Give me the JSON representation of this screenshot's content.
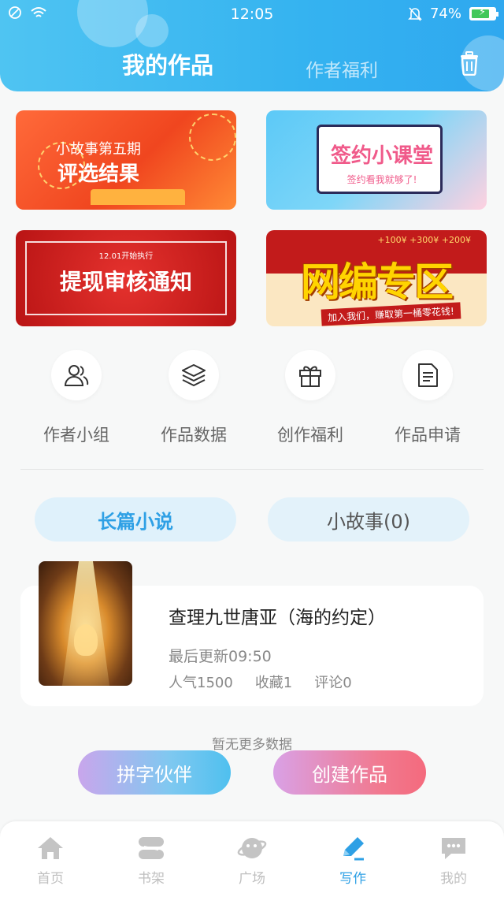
{
  "status_bar": {
    "time": "12:05",
    "battery": "74%"
  },
  "header": {
    "tabs": [
      {
        "label": "我的作品",
        "active": true
      },
      {
        "label": "作者福利",
        "active": false
      }
    ],
    "icons": [
      "trash-icon"
    ]
  },
  "banners": [
    {
      "line1": "小故事第五期",
      "line2": "评选结果"
    },
    {
      "line1": "签约小课堂",
      "line2": "签约看我就够了!"
    },
    {
      "line0": "12.01开始执行",
      "line1": "提现审核通知"
    },
    {
      "line0": "+100¥  +300¥  +200¥",
      "line1": "网编专区",
      "line2": "加入我们，赚取第一桶零花钱!"
    }
  ],
  "quick_menu": [
    {
      "label": "作者小组",
      "icon": "users-icon"
    },
    {
      "label": "作品数据",
      "icon": "layers-icon"
    },
    {
      "label": "创作福利",
      "icon": "gift-icon"
    },
    {
      "label": "作品申请",
      "icon": "document-icon"
    }
  ],
  "segments": [
    {
      "label": "长篇小说",
      "active": true
    },
    {
      "label": "小故事(0)",
      "active": false
    }
  ],
  "work": {
    "title": "查理九世唐亚（海的约定）",
    "updated": "最后更新09:50",
    "popularity": "人气1500",
    "favorites": "收藏1",
    "comments": "评论0"
  },
  "no_more": "暂无更多数据",
  "actions": {
    "partner": "拼字伙伴",
    "create": "创建作品"
  },
  "bottom_nav": [
    {
      "label": "首页",
      "icon": "home-icon",
      "active": false
    },
    {
      "label": "书架",
      "icon": "bookshelf-icon",
      "active": false
    },
    {
      "label": "广场",
      "icon": "planet-icon",
      "active": false
    },
    {
      "label": "写作",
      "icon": "pen-icon",
      "active": true
    },
    {
      "label": "我的",
      "icon": "chat-bubble-icon",
      "active": false
    }
  ],
  "colors": {
    "accent": "#2ea0e5",
    "header_start": "#4fc4f2",
    "header_end": "#2fa8ef"
  }
}
